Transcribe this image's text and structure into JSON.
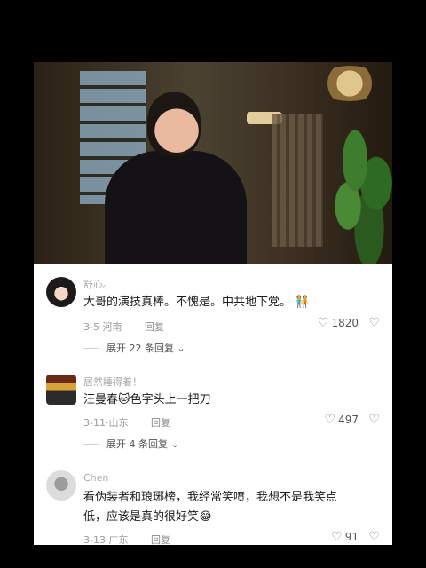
{
  "video": {
    "alt": "drama scene"
  },
  "comments": [
    {
      "user": "舒心。",
      "text": "大哥的演技真棒。不愧是。中共地下党。",
      "emoji": "🧑‍🤝‍🧑",
      "date": "3-5",
      "location": "河南",
      "reply_label": "回复",
      "likes": "1820",
      "expand": "展开 22 条回复 ⌄"
    },
    {
      "user": "居然睡得着！",
      "text_before": "汪曼春",
      "emoji": "🐱",
      "text_after": "色字头上一把刀",
      "date": "3-11",
      "location": "山东",
      "reply_label": "回复",
      "likes": "497",
      "expand": "展开 4 条回复 ⌄"
    },
    {
      "user": "Chen",
      "text_line1": "看伪装者和琅琊榜，我经常笑喷，我想不是我笑点",
      "text_line2": "低，应该是真的很好笑",
      "emoji": "😂",
      "date": "3-13",
      "location": "广东",
      "reply_label": "回复",
      "likes": "91"
    }
  ]
}
